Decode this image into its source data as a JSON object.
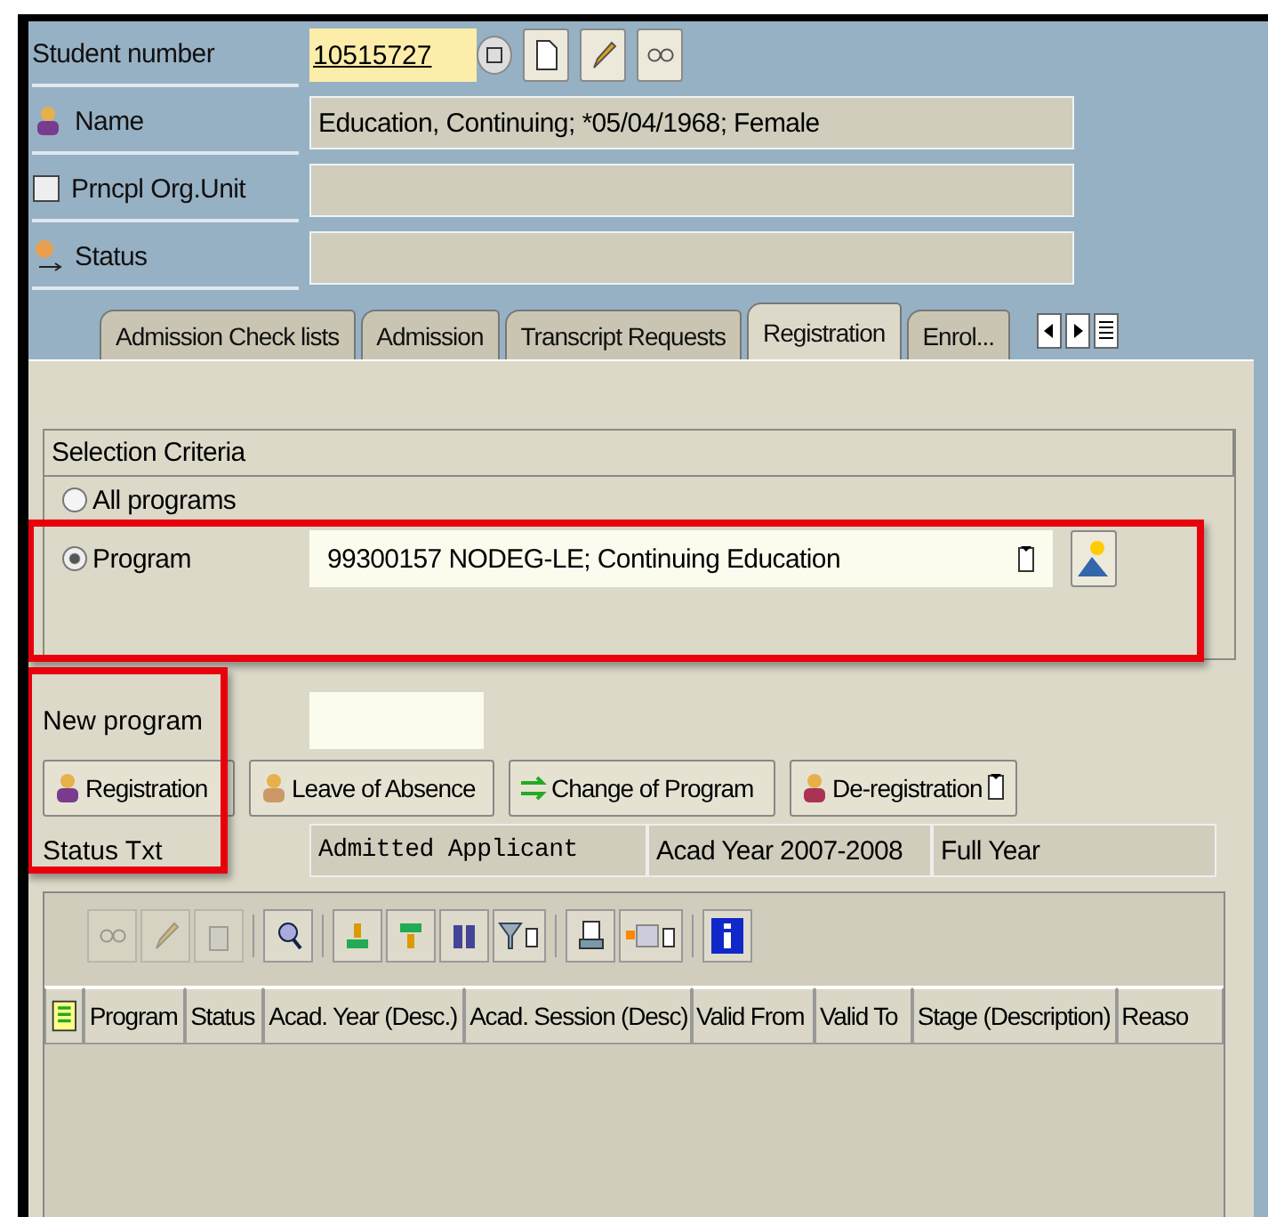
{
  "header": {
    "student_number": {
      "label": "Student number",
      "value": "10515727"
    },
    "name": {
      "label": "Name",
      "value": "Education, Continuing; *05/04/1968; Female"
    },
    "org_unit": {
      "label": "Prncpl Org.Unit"
    },
    "status": {
      "label": "Status"
    }
  },
  "tabs": [
    {
      "label": "Admission Check lists",
      "selected": false
    },
    {
      "label": "Admission",
      "selected": false
    },
    {
      "label": "Transcript Requests",
      "selected": false
    },
    {
      "label": "Registration",
      "selected": true
    },
    {
      "label": "Enrol...",
      "selected": false
    }
  ],
  "selection": {
    "title": "Selection Criteria",
    "options": [
      {
        "label": "All programs",
        "selected": false
      },
      {
        "label": "Program",
        "selected": true
      }
    ],
    "program_value": "99300157 NODEG-LE; Continuing Education"
  },
  "new_program": {
    "label": "New program"
  },
  "actions": [
    {
      "label": "Registration",
      "kind": "plain"
    },
    {
      "label": "Leave of Absence",
      "kind": "plain"
    },
    {
      "label": "Change of Program",
      "kind": "plain"
    },
    {
      "label": "De-registration",
      "kind": "menu"
    }
  ],
  "status_row": {
    "label": "Status Txt",
    "values": [
      "Admitted Applicant",
      "Acad Year 2007-2008",
      "Full Year"
    ]
  },
  "grid": {
    "toolbar": [
      {
        "kind": "glasses",
        "disabled": true
      },
      {
        "kind": "pencil",
        "disabled": true
      },
      {
        "kind": "trash",
        "disabled": true
      },
      {
        "kind": "details",
        "disabled": false
      },
      {
        "kind": "sort-up",
        "disabled": false
      },
      {
        "kind": "sort-down",
        "disabled": false
      },
      {
        "kind": "find",
        "disabled": false
      },
      {
        "kind": "filter",
        "disabled": false
      },
      {
        "kind": "print",
        "disabled": false
      },
      {
        "kind": "layout",
        "disabled": false
      },
      {
        "kind": "info",
        "disabled": false
      }
    ],
    "columns": [
      "Program",
      "Status",
      "Acad. Year (Desc.)",
      "Acad. Session (Desc)",
      "Valid From",
      "Valid To",
      "Stage (Description)",
      "Reaso"
    ]
  }
}
